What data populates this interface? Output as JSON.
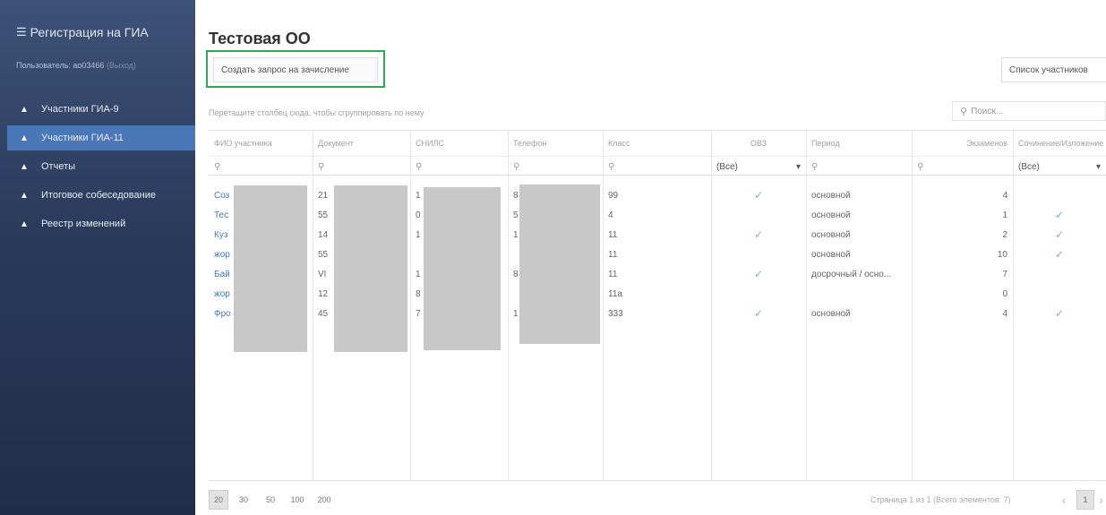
{
  "sidebar": {
    "brand": "Регистрация на ГИА",
    "user_label": "Пользователь: ao03466",
    "user_action": "(Выход)",
    "items": [
      {
        "label": "Участники ГИА-9",
        "icon": "car-icon",
        "active": false
      },
      {
        "label": "Участники ГИА-11",
        "icon": "car-icon",
        "active": true
      },
      {
        "label": "Отчеты",
        "icon": "car-icon",
        "active": false
      },
      {
        "label": "Итоговое собеседование",
        "icon": "car-icon",
        "active": false
      },
      {
        "label": "Реестр изменений",
        "icon": "car-icon",
        "active": false
      }
    ]
  },
  "main": {
    "title": "Тестовая ОО",
    "create_button": "Создать запрос на зачисление",
    "list_button": "Список участников",
    "group_hint": "Перетащите столбец сюда, чтобы сгруппировать по нему",
    "search_placeholder": "Поиск...",
    "highlight_color": "#2fa84f"
  },
  "grid": {
    "columns": [
      "ФИО участника",
      "Документ",
      "СНИЛС",
      "Телефон",
      "Класс",
      "ОВЗ",
      "Период",
      "Экзаменов",
      "Сочинение/Изложение"
    ],
    "filter_all": "(Все)",
    "rows": [
      {
        "fio": "Соз",
        "doc": "21",
        "snils": "1",
        "phone": "8",
        "class": "99",
        "ovz": true,
        "period": "основной",
        "exams": "4",
        "essay": false
      },
      {
        "fio": "Тес",
        "doc": "55",
        "snils": "0",
        "phone": "5",
        "class": "4",
        "ovz": false,
        "period": "основной",
        "exams": "1",
        "essay": true
      },
      {
        "fio": "Куз",
        "doc": "14",
        "snils": "1",
        "phone": "1",
        "class": "11",
        "ovz": true,
        "period": "основной",
        "exams": "2",
        "essay": true
      },
      {
        "fio": "жор",
        "doc": "55",
        "snils": "",
        "phone": "",
        "class": "11",
        "ovz": false,
        "period": "основной",
        "exams": "10",
        "essay": true
      },
      {
        "fio": "Бай",
        "doc": "VI",
        "snils": "1",
        "phone": "8",
        "class": "11",
        "ovz": true,
        "period": "досрочный / осно...",
        "exams": "7",
        "essay": false
      },
      {
        "fio": "жор",
        "doc": "12",
        "snils": "8",
        "phone": "",
        "class": "11а",
        "ovz": false,
        "period": "",
        "exams": "0",
        "essay": false
      },
      {
        "fio": "Фро",
        "doc": "45",
        "snils": "7",
        "phone": "1",
        "class": "333",
        "ovz": true,
        "period": "основной",
        "exams": "4",
        "essay": true
      }
    ]
  },
  "footer": {
    "page_sizes": [
      "20",
      "30",
      "50",
      "100",
      "200"
    ],
    "active_size": "20",
    "page_info": "Страница 1 из 1 (Всего элементов: 7)",
    "current_page": "1",
    "prev": "‹",
    "next": "›"
  }
}
